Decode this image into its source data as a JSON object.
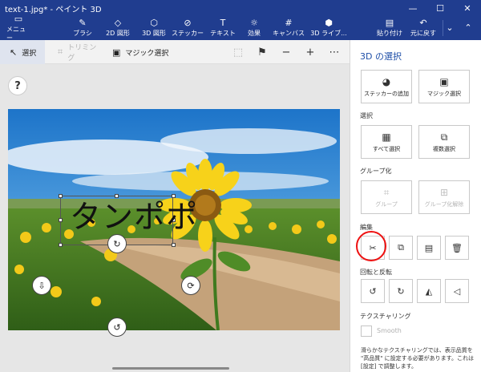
{
  "window": {
    "title": "text-1.jpg* - ペイント 3D",
    "minimize": "—",
    "maximize": "☐",
    "close": "✕"
  },
  "ribbon": {
    "menu": "メニュー",
    "brush": "ブラシ",
    "shapes2d": "2D 図形",
    "shapes3d": "3D 図形",
    "stickers": "ステッカー",
    "text": "テキスト",
    "effects": "効果",
    "canvas": "キャンバス",
    "library3d": "3D ライブ...",
    "paste": "貼り付け",
    "undo": "元に戻す"
  },
  "toolbar": {
    "select": "選択",
    "crop": "トリミング",
    "magic_select": "マジック選択"
  },
  "canvas": {
    "help": "?",
    "selected_text": "タンポポ"
  },
  "panel": {
    "title": "3D の選択",
    "add_sticker": "ステッカーの追加",
    "magic_select": "マジック選択",
    "select_section": "選択",
    "select_all": "すべて選択",
    "multi_select": "複数選択",
    "group_section": "グループ化",
    "group": "グループ",
    "ungroup": "グループ化解除",
    "edit_section": "編集",
    "rotate_section": "回転と反転",
    "texturing_section": "テクスチャリング",
    "smooth": "Smooth",
    "note": "滑らかなテクスチャリングでは、表示品質を \"高品質\" に設定する必要があります。これは [設定] で調整します。"
  },
  "colors": {
    "titlebar": "#203d8f",
    "accent": "#1f4fa8",
    "highlight_ring": "#e11111"
  }
}
